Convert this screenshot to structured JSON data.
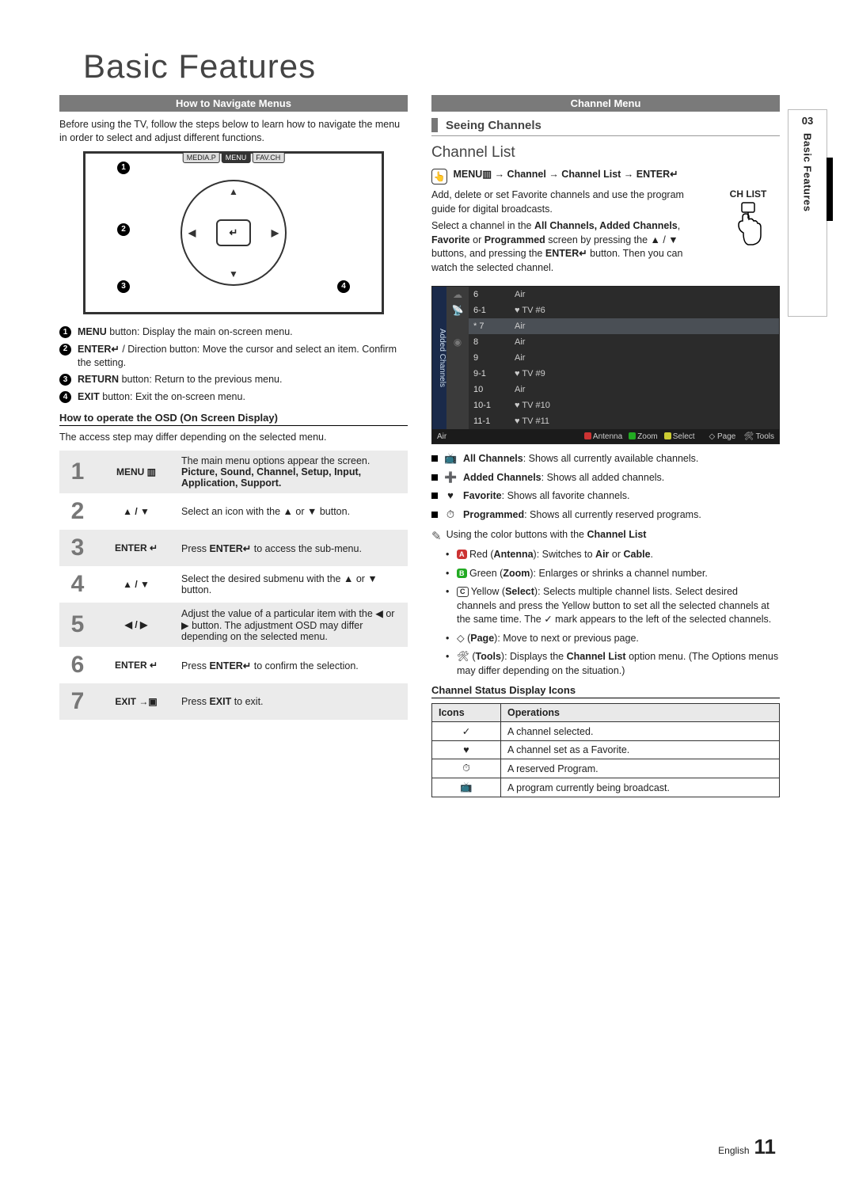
{
  "title": "Basic Features",
  "side_tab": {
    "num": "03",
    "label": "Basic Features"
  },
  "left": {
    "section_bar": "How to Navigate Menus",
    "intro": "Before using the TV, follow the steps below to learn how to navigate the menu in order to select and adjust different functions.",
    "remote_top_buttons": {
      "left": "MEDIA.P",
      "middle": "MENU",
      "right": "FAV.CH"
    },
    "remote_enter_glyph": "↵",
    "buttons": [
      {
        "n": "1",
        "label": "MENU",
        "text": " button: Display the main on-screen menu."
      },
      {
        "n": "2",
        "label": "ENTER↵",
        "text": " / Direction button: Move the cursor and select an item. Confirm the setting."
      },
      {
        "n": "3",
        "label": "RETURN",
        "text": " button: Return to the previous menu."
      },
      {
        "n": "4",
        "label": "EXIT",
        "text": " button: Exit the on-screen menu."
      }
    ],
    "osd_header": "How to operate the OSD (On Screen Display)",
    "osd_note": "The access step may differ depending on the selected menu.",
    "steps": [
      {
        "n": "1",
        "btn": "MENU ▥",
        "desc_pre": "The main menu options appear the screen.",
        "desc_bold": "Picture, Sound, Channel, Setup, Input, Application, Support."
      },
      {
        "n": "2",
        "btn": "▲ / ▼",
        "desc": "Select an icon with the ▲ or ▼ button."
      },
      {
        "n": "3",
        "btn": "ENTER ↵",
        "desc_pre": "Press ",
        "desc_bold": "ENTER↵",
        "desc_post": " to access the sub-menu."
      },
      {
        "n": "4",
        "btn": "▲ / ▼",
        "desc": "Select the desired submenu with the ▲ or ▼ button."
      },
      {
        "n": "5",
        "btn": "◀ / ▶",
        "desc": "Adjust the value of a particular item with the ◀ or ▶ button. The adjustment OSD may differ depending on the selected menu."
      },
      {
        "n": "6",
        "btn": "ENTER ↵",
        "desc_pre": "Press ",
        "desc_bold": "ENTER↵",
        "desc_post": " to confirm the selection."
      },
      {
        "n": "7",
        "btn": "EXIT →▣",
        "desc_pre": "Press ",
        "desc_bold": "EXIT",
        "desc_post": " to exit."
      }
    ]
  },
  "right": {
    "section_bar": "Channel Menu",
    "sub_header": "Seeing Channels",
    "sec_title": "Channel List",
    "menu_path": {
      "glyph": "👆",
      "text": "MENU▥ → Channel → Channel List → ENTER↵"
    },
    "ch_list_label": "CH LIST",
    "para1": "Add, delete or set Favorite channels and use the program guide for digital broadcasts.",
    "para2_pre": "Select a channel in the ",
    "para2_bold1": "All Channels, Added Channels",
    "para2_mid": ", ",
    "para2_bold2": "Favorite",
    "para2_mid2": " or ",
    "para2_bold3": "Programmed",
    "para2_post": " screen by pressing the ▲ / ▼ buttons, and pressing the ",
    "para2_bold4": "ENTER↵",
    "para2_end": " button. Then you can watch the selected channel.",
    "panel": {
      "side_label": "Added Channels",
      "left_col_glyphs": [
        "☁",
        "📡",
        "",
        "◉",
        "",
        "",
        "",
        ""
      ],
      "rows": [
        {
          "ch": "6",
          "ant": "Air",
          "hl": false
        },
        {
          "ch": "6-1",
          "ant": "♥ TV #6",
          "hl": false
        },
        {
          "ch": "* 7",
          "ant": "Air",
          "hl": true
        },
        {
          "ch": "8",
          "ant": "Air",
          "hl": false
        },
        {
          "ch": "9",
          "ant": "Air",
          "hl": false
        },
        {
          "ch": "9-1",
          "ant": "♥ TV #9",
          "hl": false
        },
        {
          "ch": "10",
          "ant": "Air",
          "hl": false
        },
        {
          "ch": "10-1",
          "ant": "♥ TV #10",
          "hl": false
        },
        {
          "ch": "11-1",
          "ant": "♥ TV #11",
          "hl": false
        }
      ],
      "foot_left": "Air",
      "foot_items": [
        {
          "c": "red",
          "t": "Antenna"
        },
        {
          "c": "green",
          "t": "Zoom"
        },
        {
          "c": "yellow",
          "t": "Select"
        }
      ],
      "foot_page": "◇ Page",
      "foot_tools": "🛠 Tools"
    },
    "features": [
      {
        "ic": "📺",
        "bold": "All Channels",
        "text": ": Shows all currently available channels."
      },
      {
        "ic": "➕",
        "bold": "Added Channels",
        "text": ": Shows all added channels."
      },
      {
        "ic": "♥",
        "bold": "Favorite",
        "text": ": Shows all favorite channels."
      },
      {
        "ic": "⏱",
        "bold": "Programmed",
        "text": ": Shows all currently reserved programs."
      }
    ],
    "note": "Using the color buttons with the ",
    "note_bold": "Channel List",
    "colors": [
      {
        "chip_cls": "chip-red",
        "chip_letter": "A",
        "pre": " Red (",
        "bold": "Antenna",
        "post": "): Switches to ",
        "bold2": "Air",
        "post2": " or ",
        "bold3": "Cable",
        "end": "."
      },
      {
        "chip_cls": "chip-green",
        "chip_letter": "B",
        "pre": " Green (",
        "bold": "Zoom",
        "post": "): Enlarges or shrinks a channel number."
      },
      {
        "chip_cls": "chip-yellow-box",
        "chip_letter": "C",
        "pre": " Yellow (",
        "bold": "Select",
        "post": "): Selects multiple channel lists. Select desired channels and press the Yellow button to set all the selected channels at the same time. The ✓ mark appears to the left of the selected channels."
      },
      {
        "sym": "◇",
        "pre": " (",
        "bold": "Page",
        "post": "): Move to next or previous page."
      },
      {
        "sym": "🛠",
        "pre": " (",
        "bold": "Tools",
        "post": "): Displays the ",
        "bold2": "Channel List",
        "post2": " option menu. (The Options menus may differ depending on the situation.)"
      }
    ],
    "status_header": "Channel Status Display Icons",
    "status_table": {
      "th1": "Icons",
      "th2": "Operations",
      "rows": [
        {
          "ic": "✓",
          "op": "A channel selected."
        },
        {
          "ic": "♥",
          "op": "A channel set as a Favorite."
        },
        {
          "ic": "⏱",
          "op": "A reserved Program."
        },
        {
          "ic": "📺",
          "op": "A program currently being broadcast."
        }
      ]
    }
  },
  "footer": {
    "lang": "English",
    "page": "11"
  }
}
